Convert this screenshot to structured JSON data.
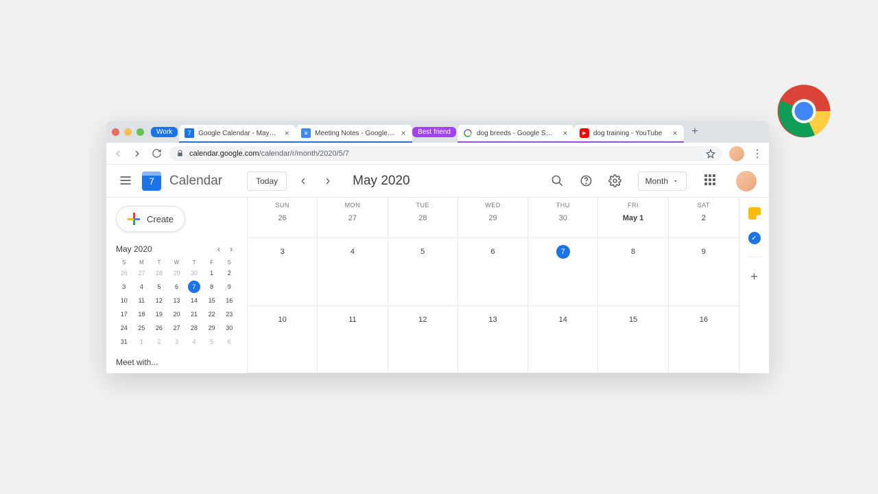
{
  "chrome": {
    "traffic_colors": [
      "#ed6a5e",
      "#f5bf4f",
      "#62c554"
    ],
    "groups": [
      {
        "label": "Work",
        "color": "blue"
      },
      {
        "label": "Best friend",
        "color": "purple"
      }
    ],
    "tabs": [
      {
        "title": "Google Calendar - May 2020",
        "favicon": "calendar-icon",
        "group": 0,
        "active": true
      },
      {
        "title": "Meeting Notes - Google Docs",
        "favicon": "docs-icon",
        "group": 0
      },
      {
        "title": "dog breeds - Google Search",
        "favicon": "google-icon",
        "group": 1
      },
      {
        "title": "dog training - YouTube",
        "favicon": "youtube-icon",
        "group": 1
      }
    ],
    "url_host": "calendar.google.com",
    "url_path": "/calendar/r/month/2020/5/7"
  },
  "app": {
    "name": "Calendar",
    "logo_day": "7",
    "today_label": "Today",
    "title": "May 2020",
    "view_label": "Month"
  },
  "sidebar": {
    "create_label": "Create",
    "mini_title": "May 2020",
    "dow": [
      "S",
      "M",
      "T",
      "W",
      "T",
      "F",
      "S"
    ],
    "mini_days": [
      {
        "n": "26",
        "m": true
      },
      {
        "n": "27",
        "m": true
      },
      {
        "n": "28",
        "m": true
      },
      {
        "n": "29",
        "m": true
      },
      {
        "n": "30",
        "m": true
      },
      {
        "n": "1"
      },
      {
        "n": "2"
      },
      {
        "n": "3"
      },
      {
        "n": "4"
      },
      {
        "n": "5"
      },
      {
        "n": "6"
      },
      {
        "n": "7",
        "today": true
      },
      {
        "n": "8"
      },
      {
        "n": "9"
      },
      {
        "n": "10"
      },
      {
        "n": "11"
      },
      {
        "n": "12"
      },
      {
        "n": "13"
      },
      {
        "n": "14"
      },
      {
        "n": "15"
      },
      {
        "n": "16"
      },
      {
        "n": "17"
      },
      {
        "n": "18"
      },
      {
        "n": "19"
      },
      {
        "n": "20"
      },
      {
        "n": "21"
      },
      {
        "n": "22"
      },
      {
        "n": "23"
      },
      {
        "n": "24"
      },
      {
        "n": "25"
      },
      {
        "n": "26"
      },
      {
        "n": "27"
      },
      {
        "n": "28"
      },
      {
        "n": "29"
      },
      {
        "n": "30"
      },
      {
        "n": "31"
      },
      {
        "n": "1",
        "m": true
      },
      {
        "n": "2",
        "m": true
      },
      {
        "n": "3",
        "m": true
      },
      {
        "n": "4",
        "m": true
      },
      {
        "n": "5",
        "m": true
      },
      {
        "n": "6",
        "m": true
      }
    ],
    "meet_with": "Meet with..."
  },
  "calendar": {
    "dow": [
      "SUN",
      "MON",
      "TUE",
      "WED",
      "THU",
      "FRI",
      "SAT"
    ],
    "row0": [
      {
        "label": "26"
      },
      {
        "label": "27"
      },
      {
        "label": "28"
      },
      {
        "label": "29"
      },
      {
        "label": "30"
      },
      {
        "label": "May 1",
        "in": true,
        "bold": true
      },
      {
        "label": "2",
        "in": true
      }
    ],
    "row1": [
      {
        "label": "3",
        "in": true
      },
      {
        "label": "4",
        "in": true
      },
      {
        "label": "5",
        "in": true
      },
      {
        "label": "6",
        "in": true
      },
      {
        "label": "7",
        "in": true,
        "today": true
      },
      {
        "label": "8",
        "in": true
      },
      {
        "label": "9",
        "in": true
      }
    ],
    "row2": [
      {
        "label": "10",
        "in": true
      },
      {
        "label": "11",
        "in": true
      },
      {
        "label": "12",
        "in": true
      },
      {
        "label": "13",
        "in": true
      },
      {
        "label": "14",
        "in": true
      },
      {
        "label": "15",
        "in": true
      },
      {
        "label": "16",
        "in": true
      }
    ]
  }
}
